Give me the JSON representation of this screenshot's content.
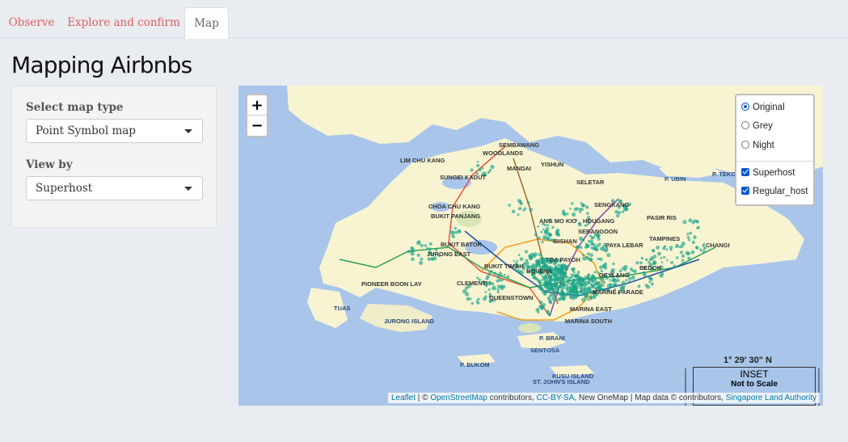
{
  "tabs": [
    {
      "label": "Observe"
    },
    {
      "label": "Explore and confirm"
    },
    {
      "label": "Map"
    }
  ],
  "page_title": "Mapping Airbnbs",
  "sidebar": {
    "map_type_label": "Select map type",
    "map_type_value": "Point Symbol map",
    "view_by_label": "View by",
    "view_by_value": "Superhost"
  },
  "map": {
    "zoom_in": "+",
    "zoom_out": "−",
    "layers": {
      "basemaps": [
        {
          "label": "Original",
          "selected": true
        },
        {
          "label": "Grey",
          "selected": false
        },
        {
          "label": "Night",
          "selected": false
        }
      ],
      "overlays": [
        {
          "label": "Superhost",
          "checked": true
        },
        {
          "label": "Regular_host",
          "checked": true
        }
      ]
    },
    "place_labels": [
      "SEMBAWANG",
      "WOODLANDS",
      "MANDAI",
      "YISHUN",
      "LIM CHU KANG",
      "SUNGEI KADUT",
      "SELETAR",
      "P. UBIN",
      "P. TEKO",
      "CHOA CHU KANG",
      "BUKIT PANJANG",
      "SENGKANG",
      "ANG MO KIO",
      "HOUGANG",
      "PASIR RIS",
      "SERANGOON",
      "TAMPINES",
      "CHANGI",
      "BISHAN",
      "PAYA LEBAR",
      "BUKIT BATOK",
      "JURONG EAST",
      "BUKIT TIMAH",
      "TOA PAYOH",
      "BEDOK",
      "NOVENA",
      "PIONEER BOON LAY",
      "CLEMENTI",
      "GEYLANG",
      "MARINE PARADE",
      "QUEENSTOWN",
      "TUAS",
      "JURONG ISLAND",
      "MARINA EAST",
      "MARINA SOUTH",
      "P. BRANI",
      "SENTOSA",
      "P. BUKOM",
      "KUSU ISLAND",
      "ST. JOHN'S ISLAND"
    ],
    "coord_text": "1° 29' 30\" N",
    "inset_title": "INSET",
    "inset_subtitle": "Not to Scale",
    "attribution": {
      "leaflet": "Leaflet",
      "sep1": " | © ",
      "osm": "OpenStreetMap",
      "contrib": " contributors, ",
      "license": "CC-BY-SA",
      "onemap": ", New OneMap | Map data © contributors, ",
      "sla": "Singapore Land Authority"
    },
    "colors": {
      "point": "#1aa58a",
      "land": "#f8f4d2",
      "sea": "#a9c5ea"
    }
  }
}
